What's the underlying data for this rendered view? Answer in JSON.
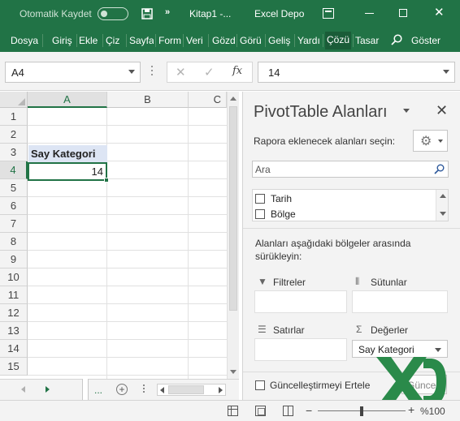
{
  "titlebar": {
    "autosave_label": "Otomatik Kaydet",
    "doc_title": "Kitap1 -...",
    "app_title": "Excel Depo",
    "accent_color": "#217346"
  },
  "ribbon": {
    "tabs": [
      "Dosya",
      "Giriş",
      "Ekle",
      "Çiz",
      "Sayfa",
      "Form",
      "Veri",
      "Gözd",
      "Görü",
      "Geliş",
      "Yardı",
      "Çözü",
      "Tasar"
    ],
    "active_tab": "Çözü",
    "show_label": "Göster"
  },
  "formula_bar": {
    "name_box": "A4",
    "formula": "14",
    "fx_label": "fx"
  },
  "grid": {
    "columns": [
      "A",
      "B",
      "C"
    ],
    "selected_column": "A",
    "rows": [
      "1",
      "2",
      "3",
      "4",
      "5",
      "6",
      "7",
      "8",
      "9",
      "10",
      "11",
      "12",
      "13",
      "14",
      "15"
    ],
    "selected_row": "4",
    "cells": {
      "A3": "Say Kategori",
      "A4": "14"
    }
  },
  "sheet_bar": {
    "ellipsis": "..."
  },
  "pivot": {
    "title": "PivotTable Alanları",
    "choose_fields": "Rapora eklenecek alanları seçin:",
    "search_placeholder": "Ara",
    "fields": [
      {
        "label": "Tarih",
        "checked": false
      },
      {
        "label": "Bölge",
        "checked": false
      }
    ],
    "drag_hint": "Alanları aşağıdaki bölgeler arasında sürükleyin:",
    "areas": {
      "filters": "Filtreler",
      "columns": "Sütunlar",
      "rows": "Satırlar",
      "values": "Değerler"
    },
    "values_item": "Say Kategori",
    "defer_update": "Güncelleştirmeyi Ertele",
    "update_button": "Güncelle"
  },
  "status_bar": {
    "zoom": "%100",
    "zoom_percent": 100
  }
}
